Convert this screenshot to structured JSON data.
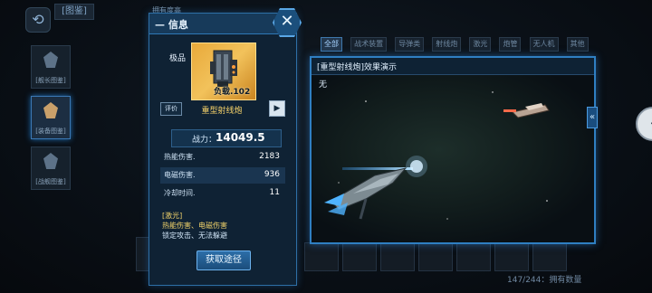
{
  "top": {
    "encyclopedia_tab": "[图鉴]",
    "owned_degree_label": "拥有度高"
  },
  "sidebar": {
    "items": [
      {
        "label": "[舰长图鉴]",
        "icon": "captain-icon"
      },
      {
        "label": "[装备图鉴]",
        "icon": "equipment-icon"
      },
      {
        "label": "[战舰图鉴]",
        "icon": "warship-icon"
      }
    ]
  },
  "filters": [
    "全部",
    "战术装置",
    "导弹类",
    "射线炮",
    "激光",
    "炮管",
    "无人机",
    "其他"
  ],
  "count_text": "147/244：拥有数量",
  "info_panel": {
    "title": "信息",
    "rarity": "极品",
    "load_label": "负载.102",
    "eval_button": "评价",
    "weapon_name": "重型射线炮",
    "power_label": "战力：",
    "power_value": "14049.5",
    "stats": [
      {
        "label": "热能伤害.",
        "value": "2183"
      },
      {
        "label": "电磁伤害.",
        "value": "936"
      },
      {
        "label": "冷却时间.",
        "value": "11"
      }
    ],
    "tag_category": "[激光]",
    "tag_damage": "热能伤害、电磁伤害",
    "tag_effects": "锁定攻击、无法躲避",
    "obtain_button": "获取途径"
  },
  "demo_panel": {
    "title": "[重型射线炮]效果演示",
    "content": "无"
  },
  "colors": {
    "panel_border": "#2e6fa6",
    "rarity_gold": "#f2c25b",
    "highlight_yellow": "#f0d26a",
    "beam_blue": "#4fb3ff"
  }
}
